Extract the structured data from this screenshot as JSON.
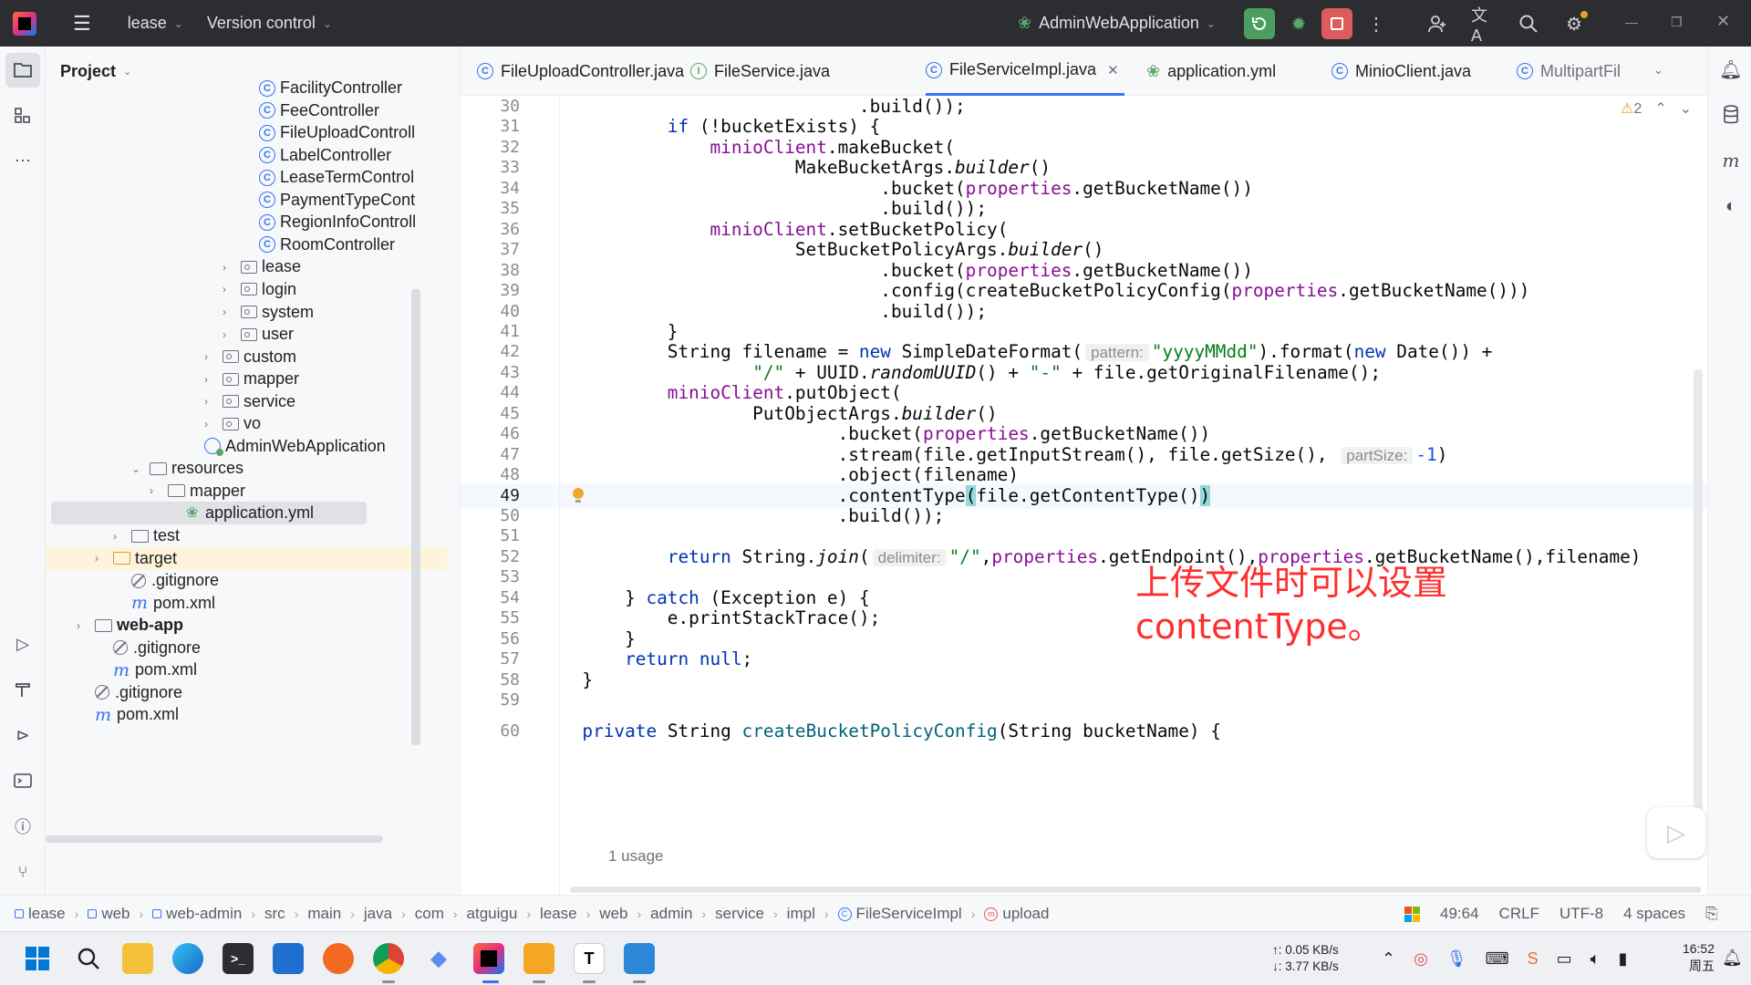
{
  "titlebar": {
    "project_name": "lease",
    "vcs_label": "Version control",
    "run_config": "AdminWebApplication"
  },
  "project_panel": {
    "title": "Project",
    "tree": [
      {
        "label": "FacilityController",
        "kind": "class",
        "depth": 11
      },
      {
        "label": "FeeController",
        "kind": "class",
        "depth": 11
      },
      {
        "label": "FileUploadControll",
        "kind": "class",
        "depth": 11
      },
      {
        "label": "LabelController",
        "kind": "class",
        "depth": 11
      },
      {
        "label": "LeaseTermControl",
        "kind": "class",
        "depth": 11
      },
      {
        "label": "PaymentTypeCont",
        "kind": "class",
        "depth": 11
      },
      {
        "label": "RegionInfoControll",
        "kind": "class",
        "depth": 11
      },
      {
        "label": "RoomController",
        "kind": "class",
        "depth": 11
      },
      {
        "label": "lease",
        "kind": "package",
        "depth": 10,
        "arrow": "›"
      },
      {
        "label": "login",
        "kind": "package",
        "depth": 10,
        "arrow": "›"
      },
      {
        "label": "system",
        "kind": "package",
        "depth": 10,
        "arrow": "›"
      },
      {
        "label": "user",
        "kind": "package",
        "depth": 10,
        "arrow": "›"
      },
      {
        "label": "custom",
        "kind": "package",
        "depth": 9,
        "arrow": "›"
      },
      {
        "label": "mapper",
        "kind": "package",
        "depth": 9,
        "arrow": "›"
      },
      {
        "label": "service",
        "kind": "package",
        "depth": 9,
        "arrow": "›"
      },
      {
        "label": "vo",
        "kind": "package",
        "depth": 9,
        "arrow": "›"
      },
      {
        "label": "AdminWebApplication",
        "kind": "app",
        "depth": 8
      },
      {
        "label": "resources",
        "kind": "folder",
        "depth": 5,
        "arrow": "⌄"
      },
      {
        "label": "mapper",
        "kind": "folder",
        "depth": 6,
        "arrow": "›"
      },
      {
        "label": "application.yml",
        "kind": "yml",
        "depth": 7,
        "selected": true
      },
      {
        "label": "test",
        "kind": "folder",
        "depth": 4,
        "arrow": "›"
      },
      {
        "label": "target",
        "kind": "folder-orange",
        "depth": 3,
        "arrow": "›",
        "highlight": true
      },
      {
        "label": ".gitignore",
        "kind": "ignore",
        "depth": 4
      },
      {
        "label": "pom.xml",
        "kind": "maven",
        "depth": 4
      },
      {
        "label": "web-app",
        "kind": "module",
        "depth": 2,
        "arrow": "›",
        "bold": true
      },
      {
        "label": ".gitignore",
        "kind": "ignore",
        "depth": 3
      },
      {
        "label": "pom.xml",
        "kind": "maven",
        "depth": 3
      },
      {
        "label": ".gitignore",
        "kind": "ignore",
        "depth": 2
      },
      {
        "label": "pom.xml",
        "kind": "maven",
        "depth": 2
      }
    ]
  },
  "tabs": [
    {
      "label": "FileUploadController.java",
      "icon": "class-icon"
    },
    {
      "label": "FileService.java",
      "icon": "interface-icon"
    },
    {
      "label": "FileServiceImpl.java",
      "icon": "class-icon",
      "active": true
    },
    {
      "label": "application.yml",
      "icon": "yml-icon"
    },
    {
      "label": "MinioClient.java",
      "icon": "class-icon"
    },
    {
      "label": "MultipartFil",
      "icon": "class-icon"
    }
  ],
  "editor": {
    "warning_count": "2",
    "usage_hint": "1 usage",
    "annotation_line1": "上传文件时可以设置",
    "annotation_line2": "contentType。",
    "lines": [
      {
        "n": "30",
        "html": "                                  .build());"
      },
      {
        "n": "31",
        "html": "                <span class='kw'>if</span> (!bucketExists) {"
      },
      {
        "n": "32",
        "html": "                    <span class='fld'>minioClient</span>.makeBucket("
      },
      {
        "n": "33",
        "html": "                            MakeBucketArgs.<span class='it'>builder</span>()"
      },
      {
        "n": "34",
        "html": "                                    .bucket(<span class='fld'>properties</span>.getBucketName())"
      },
      {
        "n": "35",
        "html": "                                    .build());"
      },
      {
        "n": "36",
        "html": "                    <span class='fld'>minioClient</span>.setBucketPolicy("
      },
      {
        "n": "37",
        "html": "                            SetBucketPolicyArgs.<span class='it'>builder</span>()"
      },
      {
        "n": "38",
        "html": "                                    .bucket(<span class='fld'>properties</span>.getBucketName())"
      },
      {
        "n": "39",
        "html": "                                    .config(createBucketPolicyConfig(<span class='fld'>properties</span>.getBucketName()))"
      },
      {
        "n": "40",
        "html": "                                    .build());"
      },
      {
        "n": "41",
        "html": "                }"
      },
      {
        "n": "42",
        "html": "                String filename = <span class='kw'>new</span> SimpleDateFormat(<span class='hint'>pattern:</span><span class='str'>\"yyyyMMdd\"</span>).format(<span class='kw'>new</span> Date()) +"
      },
      {
        "n": "43",
        "html": "                        <span class='str'>\"/\"</span> + UUID.<span class='it'>randomUUID</span>() + <span class='str'>\"-\"</span> + file.getOriginalFilename();"
      },
      {
        "n": "44",
        "html": "                <span class='fld'>minioClient</span>.putObject("
      },
      {
        "n": "45",
        "html": "                        PutObjectArgs.<span class='it'>builder</span>()"
      },
      {
        "n": "46",
        "html": "                                .bucket(<span class='fld'>properties</span>.getBucketName())"
      },
      {
        "n": "47",
        "html": "                                .stream(file.getInputStream(), file.getSize(), <span class='hint'>partSize:</span><span class='num'>-1</span>)"
      },
      {
        "n": "48",
        "html": "                                .object(filename)"
      },
      {
        "n": "49",
        "html": "                                .contentType<span class='bracket'>(</span>file.getContentType()<span class='bracket'>)</span>"
      },
      {
        "n": "50",
        "html": "                                .build());"
      },
      {
        "n": "51",
        "html": ""
      },
      {
        "n": "52",
        "html": "                <span class='kw'>return</span> String.<span class='it'>join</span>(<span class='hint'>delimiter:</span><span class='str'>\"/\"</span>,<span class='fld'>properties</span>.getEndpoint(),<span class='fld'>properties</span>.getBucketName(),filename)"
      },
      {
        "n": "53",
        "html": ""
      },
      {
        "n": "54",
        "html": "            } <span class='kw'>catch</span> (Exception e) {"
      },
      {
        "n": "55",
        "html": "                e.printStackTrace();"
      },
      {
        "n": "56",
        "html": "            }"
      },
      {
        "n": "57",
        "html": "            <span class='kw'>return null</span>;"
      },
      {
        "n": "58",
        "html": "        }"
      },
      {
        "n": "59",
        "html": ""
      },
      {
        "n": "60",
        "html": "        <span class='kw'>private</span> String <span style='color:#00627a'>createBucketPolicyConfig</span>(String bucketName) {"
      }
    ]
  },
  "breadcrumbs": [
    "lease",
    "web",
    "web-admin",
    "src",
    "main",
    "java",
    "com",
    "atguigu",
    "lease",
    "web",
    "admin",
    "service",
    "impl",
    "FileServiceImpl",
    "upload"
  ],
  "statusbar": {
    "position": "49:64",
    "line_sep": "CRLF",
    "encoding": "UTF-8",
    "indent": "4 spaces"
  },
  "taskbar": {
    "upload_speed": "↑: 0.05 KB/s",
    "download_speed": "↓: 3.77 KB/s",
    "time": "16:52",
    "day": "周五"
  }
}
